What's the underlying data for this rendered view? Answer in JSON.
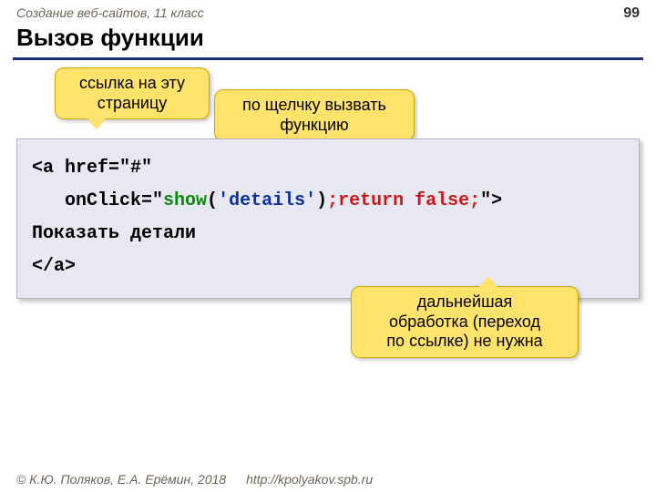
{
  "header": {
    "course": "Создание веб-сайтов, 11 класс",
    "page_number": "99"
  },
  "title": "Вызов функции",
  "callouts": {
    "c1": "ссылка на эту\nстраницу",
    "c2": "по щелчку вызвать\nфункцию",
    "c3": "дальнейшая\nобработка (переход\nпо ссылке) не нужна"
  },
  "code": {
    "l1_a": "<a href=\"#\"",
    "l2_attr": "   onClick=\"",
    "l2_show": "show",
    "l2_mid": "(",
    "l2_arg": "'details'",
    "l2_after_arg": ")",
    "l2_semi1": ";",
    "l2_ret": "return false",
    "l2_semi2": ";",
    "l2_end": "\">",
    "l3": "Показать детали",
    "l4": "</a>"
  },
  "footer": {
    "copyright": "© К.Ю. Поляков, Е.А. Ерёмин, 2018",
    "url": "http://kpolyakov.spb.ru"
  }
}
